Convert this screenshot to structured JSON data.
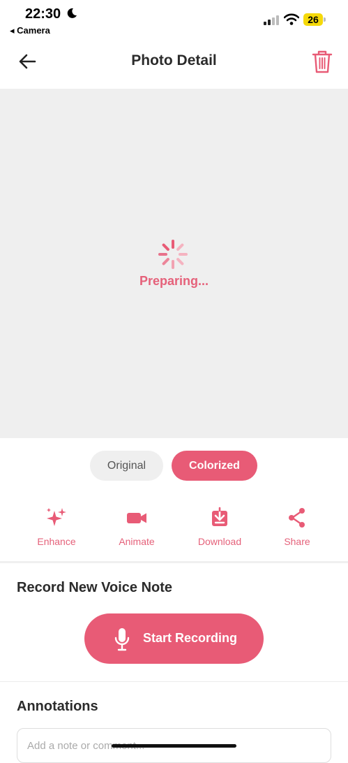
{
  "status": {
    "time": "22:30",
    "back_app": "◂ Camera",
    "battery_level": "26",
    "battery_color": "#f5d90a"
  },
  "header": {
    "title": "Photo Detail",
    "back_icon": "arrow-left-icon",
    "delete_icon": "trash-icon"
  },
  "photo": {
    "loading_text": "Preparing...",
    "background": "#efefef"
  },
  "view_toggle": {
    "options": [
      "Original",
      "Colorized"
    ],
    "selected": "Colorized"
  },
  "actions": [
    {
      "label": "Enhance",
      "icon": "sparkles-icon"
    },
    {
      "label": "Animate",
      "icon": "video-camera-icon"
    },
    {
      "label": "Download",
      "icon": "download-icon"
    },
    {
      "label": "Share",
      "icon": "share-icon"
    }
  ],
  "voice_note": {
    "title": "Record New Voice Note",
    "button_label": "Start Recording"
  },
  "annotations": {
    "title": "Annotations",
    "placeholder": "Add a note or comment..."
  },
  "colors": {
    "accent": "#e85b76",
    "text_dark": "#2b2b2b"
  }
}
